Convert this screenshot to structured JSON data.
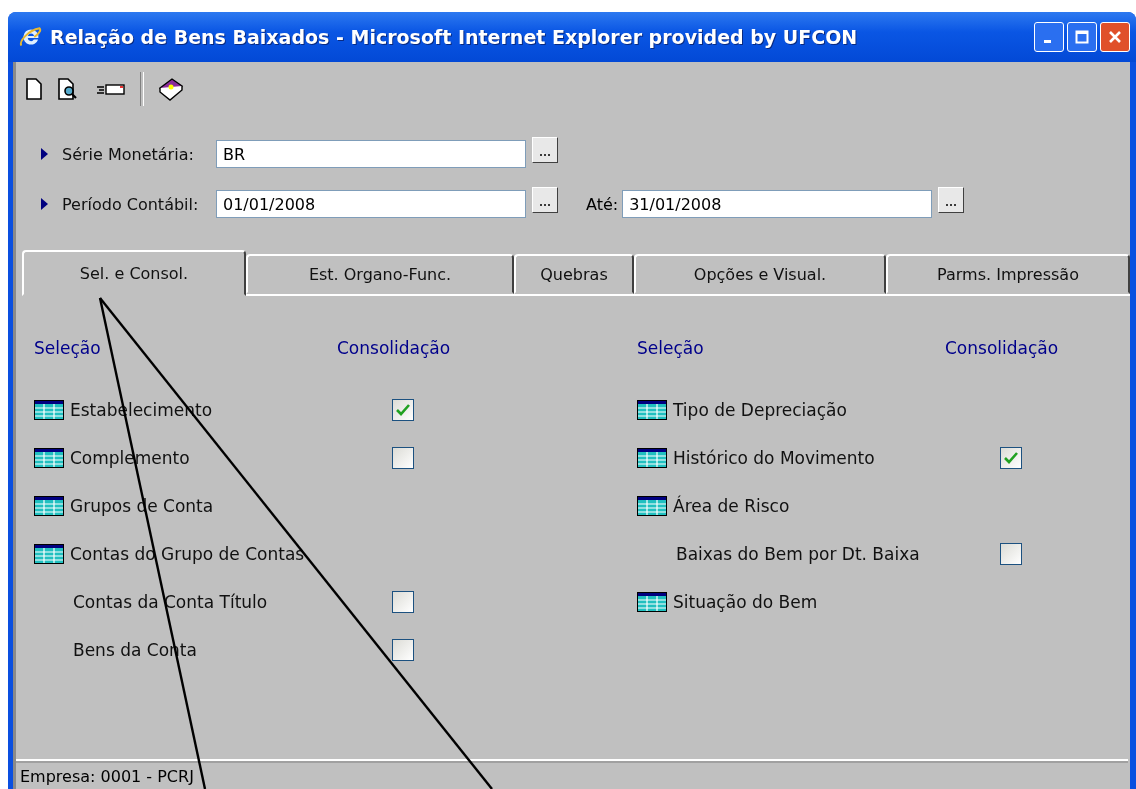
{
  "window": {
    "title": "Relação de Bens Baixados - Microsoft Internet Explorer provided by UFCON"
  },
  "toolbar": {
    "buttons": [
      {
        "kind": "new"
      },
      {
        "kind": "preview"
      },
      {
        "kind": "print"
      },
      {
        "kind": "help"
      }
    ]
  },
  "fields": [
    {
      "label": "Série Monetária:",
      "value": "BR"
    },
    {
      "label": "Período Contábil:",
      "value": "01/01/2008",
      "end_label": "Até:",
      "end_value": "31/01/2008"
    }
  ],
  "tabs": [
    {
      "label": "Sel. e Consol.",
      "selected": true
    },
    {
      "label": "Est. Organo-Func.",
      "selected": false
    },
    {
      "label": "Quebras",
      "selected": false
    },
    {
      "label": "Opções e Visual.",
      "selected": false
    },
    {
      "label": "Parms. Impressão",
      "selected": false
    }
  ],
  "columns": [
    {
      "heading_selection": "Seleção",
      "heading_consolidation": "Consolidação",
      "rows": [
        {
          "kind": "table",
          "label": "Estabelecimento",
          "checked": true
        },
        {
          "kind": "table",
          "label": "Complemento",
          "checked": false
        },
        {
          "kind": "table",
          "label": "Grupos de Conta"
        },
        {
          "kind": "table",
          "label": "Contas do Grupo de Contas"
        },
        {
          "kind": "sub",
          "label": "Contas da Conta Título",
          "checked": false
        },
        {
          "kind": "sub",
          "label": "Bens da Conta",
          "checked": false
        }
      ]
    },
    {
      "heading_selection": "Seleção",
      "heading_consolidation": "Consolidação",
      "rows": [
        {
          "kind": "table",
          "label": "Tipo de Depreciação"
        },
        {
          "kind": "table",
          "label": "Histórico do Movimento",
          "checked": true
        },
        {
          "kind": "table",
          "label": "Área de Risco"
        },
        {
          "kind": "sub",
          "label": "Baixas do Bem por Dt. Baixa",
          "checked": false
        },
        {
          "kind": "table",
          "label": "Situação do Bem"
        }
      ]
    }
  ],
  "status_bar": {
    "text": "Empresa: 0001 - PCRJ"
  }
}
